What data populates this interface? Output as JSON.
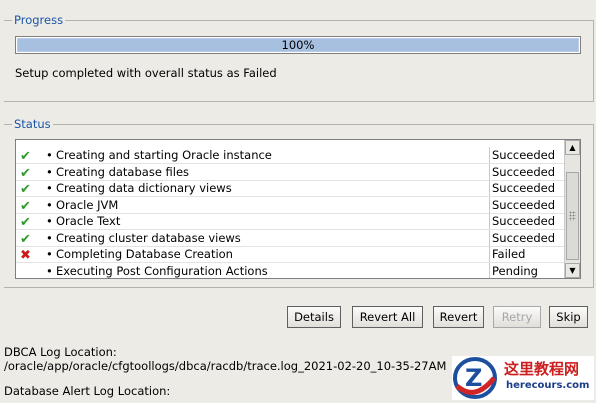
{
  "progress": {
    "legend": "Progress",
    "percent_label": "100%",
    "percent_value": 100,
    "message": "Setup completed with overall status as Failed"
  },
  "status": {
    "legend": "Status",
    "rows": [
      {
        "icon": "success-check-icon",
        "description": "Creating and starting Oracle instance",
        "status": "Succeeded"
      },
      {
        "icon": "success-check-icon",
        "description": "Creating database files",
        "status": "Succeeded"
      },
      {
        "icon": "success-check-icon",
        "description": "Creating data dictionary views",
        "status": "Succeeded"
      },
      {
        "icon": "success-check-icon",
        "description": "Oracle JVM",
        "status": "Succeeded"
      },
      {
        "icon": "success-check-icon",
        "description": "Oracle Text",
        "status": "Succeeded"
      },
      {
        "icon": "success-check-icon",
        "description": "Creating cluster database views",
        "status": "Succeeded"
      },
      {
        "icon": "failed-cross-icon",
        "description": "Completing Database Creation",
        "status": "Failed"
      },
      {
        "icon": "none",
        "description": "Executing Post Configuration Actions",
        "status": "Pending"
      }
    ]
  },
  "buttons": {
    "details": "Details",
    "revert_all": "Revert All",
    "revert": "Revert",
    "retry": "Retry",
    "skip": "Skip"
  },
  "logs": {
    "dbca_label": "DBCA Log Location:",
    "dbca_path": "/oracle/app/oracle/cfgtoollogs/dbca/racdb/trace.log_2021-02-20_10-35-27AM",
    "alert_label": "Database Alert Log Location:"
  },
  "watermark": {
    "title": "这里教程网",
    "url": "herecours.com"
  },
  "colors": {
    "legend": "#1a55a8",
    "progress_fill": "#a8c0e0",
    "success": "#2e9a2e",
    "failed": "#cc1a1a"
  }
}
